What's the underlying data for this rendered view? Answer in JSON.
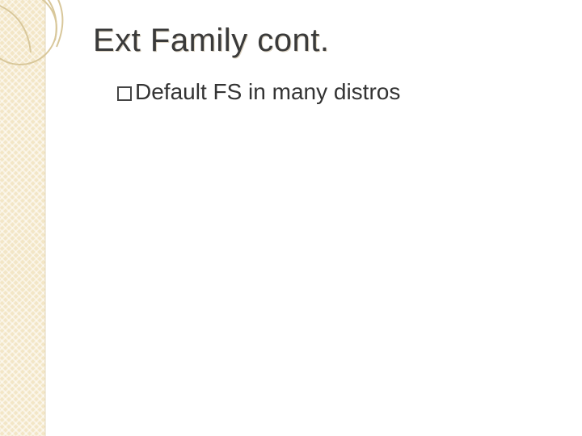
{
  "slide": {
    "title": "Ext Family cont.",
    "bullets": [
      {
        "text": "Default FS in many distros"
      }
    ]
  },
  "theme": {
    "accent_strip": "#f3e6c6",
    "motif_stroke": "#d8c79a",
    "title_color": "#3a3a3a",
    "title_shadow": "#d9d0bf"
  }
}
